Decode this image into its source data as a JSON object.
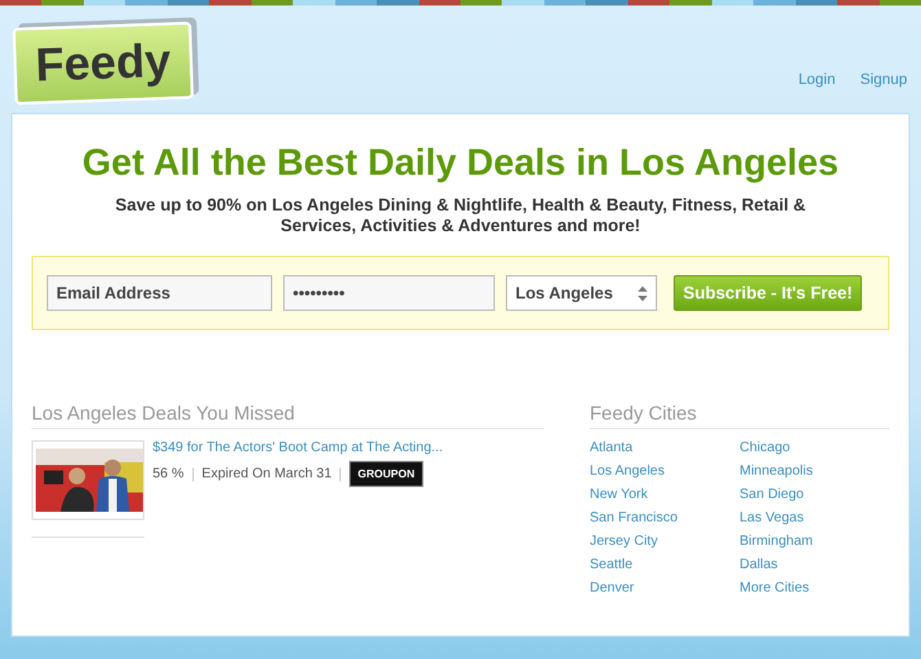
{
  "logo": {
    "text": "Feedy"
  },
  "nav": [
    "Login",
    "Signup"
  ],
  "headline": "Get All the Best Daily Deals in Los Angeles",
  "subtitle": "Save up to 90% on Los Angeles Dining & Nightlife, Health & Beauty, Fitness, Retail & Services, Activities & Adventures and more!",
  "signup_form": {
    "email": {
      "value": "Email Address"
    },
    "password": {
      "value": "•••••••••"
    },
    "city": {
      "value": "Los Angeles"
    },
    "button": "Subscribe - It's Free!"
  },
  "missed_deals": {
    "title": "Los Angeles Deals You Missed",
    "deals": [
      {
        "kind": "picture",
        "title": "$349 for The Actors' Boot Camp at The Acting...",
        "discount": "56 %",
        "status": "Expired On March 31",
        "source": "GROUPON"
      }
    ]
  },
  "cities": {
    "title": "Feedy Cities",
    "items": [
      "Atlanta",
      "Chicago",
      "Los Angeles",
      "Minneapolis",
      "New York",
      "San Diego",
      "San Francisco",
      "Las Vegas",
      "Jersey City",
      "Birmingham",
      "Seattle",
      "Dallas",
      "Denver",
      "More Cities"
    ]
  }
}
